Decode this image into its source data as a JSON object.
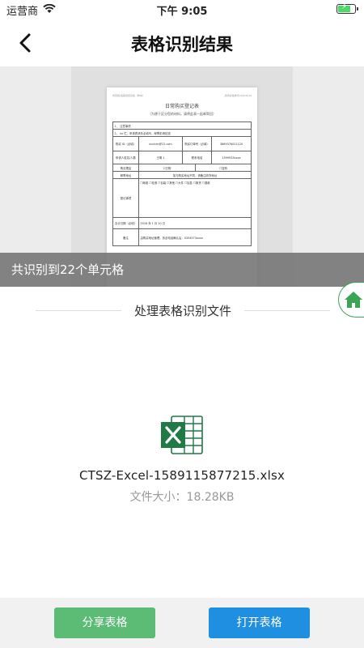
{
  "status_bar": {
    "carrier": "运营商",
    "time": "下午 9:05"
  },
  "nav": {
    "title": "表格识别结果"
  },
  "preview": {
    "doc_meta_left": "增值税/发票用纸表格（样本）",
    "doc_meta_right": "通用表格样式XLSX2019",
    "doc_title": "日常购买登记表",
    "doc_subtitle": "（为便于区分您的材料，请将此表一起邮寄回）",
    "rows": [
      [
        "1、  注意事项"
      ],
      [
        "2、  xx 栏，申请表请务必填写，邮寄前请检查"
      ],
      [
        "购买 ID（必填）",
        "xuchen@22.com",
        "购买订单号（必填）",
        "3869376021120"
      ],
      [
        "申请人姓名/人数",
        "王明 1",
        "联系电话",
        "1599933xxxx"
      ],
      [
        "购买理由",
        "☑已购",
        "☐自购"
      ],
      [
        "邮寄地址",
        "如与购买地址不同，请备注收货地址"
      ],
      [
        "登记事项",
        "☐邮费 ☐检测 ☐包装 ☐其他 ☐大件 ☐加急 ☐换货 ☐退款"
      ],
      [
        "合计日期（必填）",
        "2018 年 1 月 20 日"
      ],
      [
        "备注",
        "由购买地址管理，务必电话确认后，0354573xxxx"
      ]
    ]
  },
  "result_banner": "共识别到22个单元格",
  "section_label": "处理表格识别文件",
  "file": {
    "name": "CTSZ-Excel-1589115877215.xlsx",
    "size": "文件大小：18.28KB"
  },
  "buttons": {
    "share": "分享表格",
    "open": "打开表格"
  },
  "colors": {
    "share_green": "#5cbb74",
    "open_blue": "#1e8fe1",
    "excel_green": "#1f7a45",
    "home_green": "#3aa655"
  },
  "icons": {
    "back": "chevron-left-icon",
    "home": "home-icon",
    "file": "excel-file-icon",
    "wifi": "wifi-icon",
    "battery": "battery-charging-icon"
  }
}
